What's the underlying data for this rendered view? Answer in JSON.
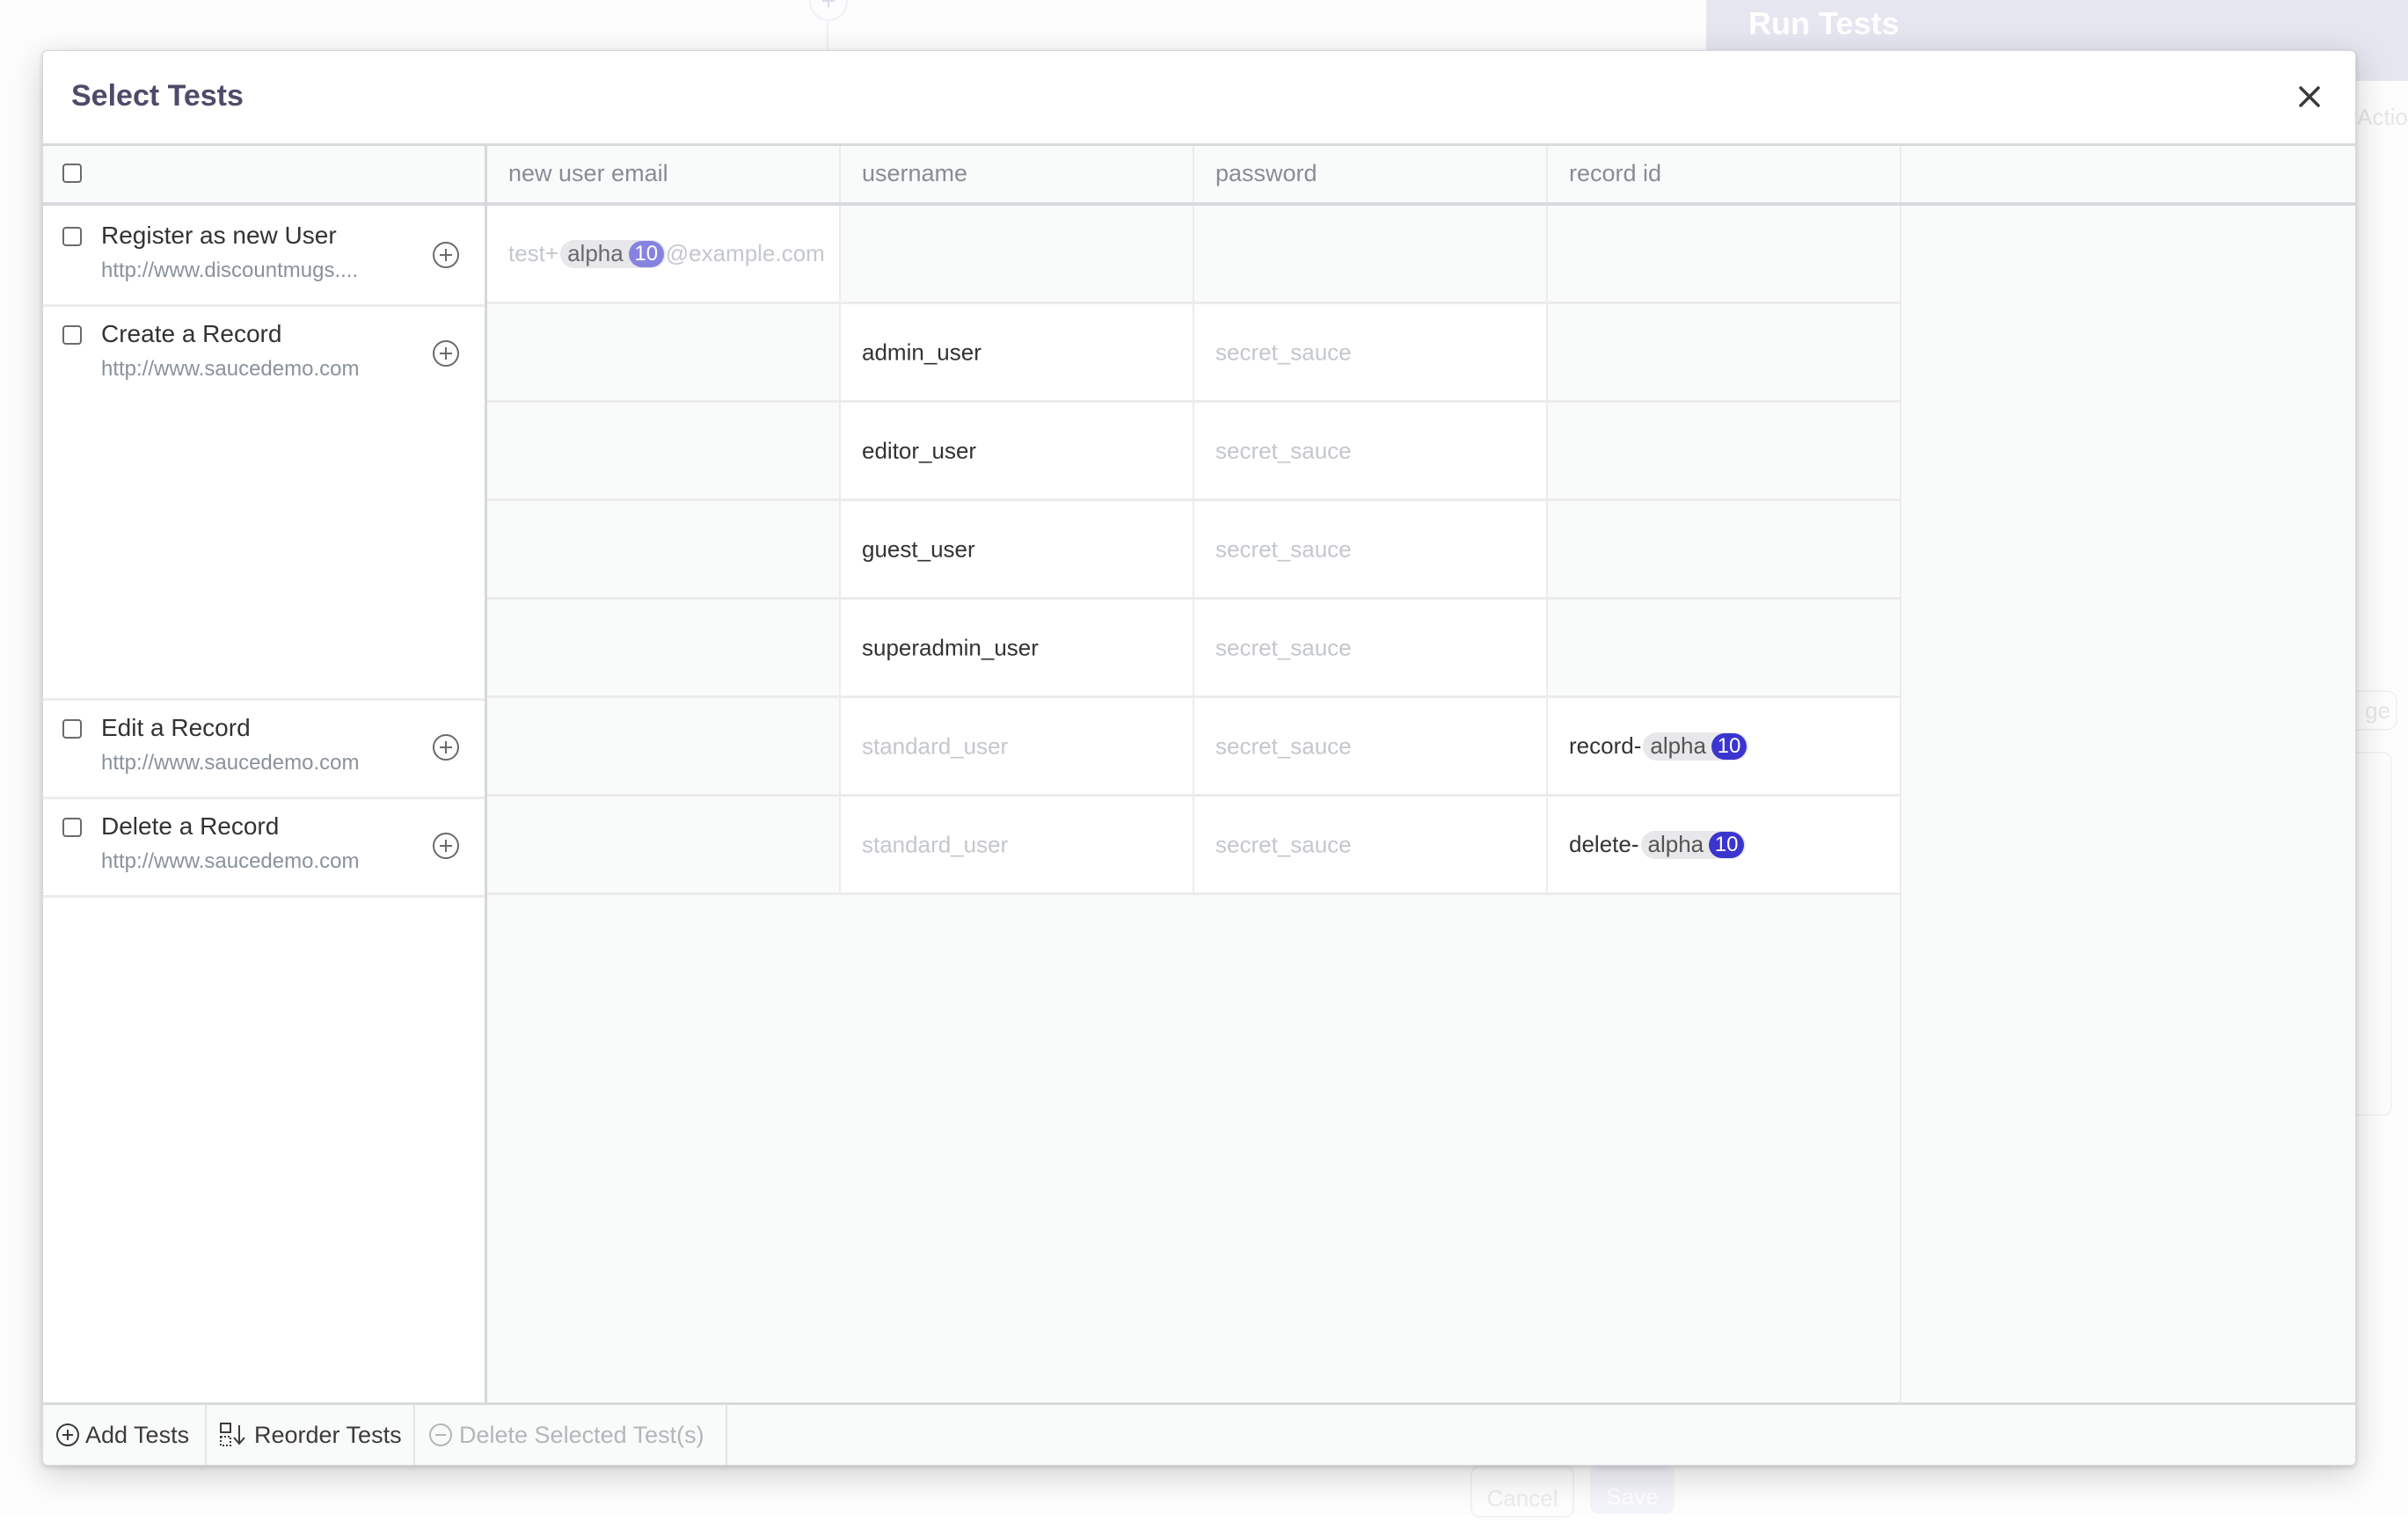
{
  "background": {
    "run_tests_title": "Run Tests",
    "actions_label": "Action",
    "tag_label": "ge",
    "cancel_label": "Cancel",
    "save_label": "Save"
  },
  "modal": {
    "title": "Select Tests",
    "close_icon": "close-icon"
  },
  "columns": [
    "new user email",
    "username",
    "password",
    "record id"
  ],
  "tests": [
    {
      "name": "Register as new User",
      "url": "http://www.discountmugs....",
      "checked": false
    },
    {
      "name": "Create a Record",
      "url": "http://www.saucedemo.com",
      "checked": false
    },
    {
      "name": "Edit a Record",
      "url": "http://www.saucedemo.com",
      "checked": false
    },
    {
      "name": "Delete a Record",
      "url": "http://www.saucedemo.com",
      "checked": false
    }
  ],
  "rows": [
    {
      "test": 0,
      "cells": [
        {
          "prefix": "test+",
          "chip": "alpha",
          "badge": "10",
          "suffix": "@example.com",
          "style": "muted"
        },
        null,
        null,
        null
      ]
    },
    {
      "test": 1,
      "cells": [
        null,
        {
          "text": "admin_user",
          "style": "dark"
        },
        {
          "text": "secret_sauce",
          "style": "muted"
        },
        null
      ]
    },
    {
      "test": 1,
      "cells": [
        null,
        {
          "text": "editor_user",
          "style": "dark"
        },
        {
          "text": "secret_sauce",
          "style": "muted"
        },
        null
      ]
    },
    {
      "test": 1,
      "cells": [
        null,
        {
          "text": "guest_user",
          "style": "dark"
        },
        {
          "text": "secret_sauce",
          "style": "muted"
        },
        null
      ]
    },
    {
      "test": 1,
      "cells": [
        null,
        {
          "text": "superadmin_user",
          "style": "dark"
        },
        {
          "text": "secret_sauce",
          "style": "muted"
        },
        null
      ]
    },
    {
      "test": 2,
      "cells": [
        null,
        {
          "text": "standard_user",
          "style": "muted"
        },
        {
          "text": "secret_sauce",
          "style": "muted"
        },
        {
          "prefix": "record-",
          "chip": "alpha",
          "badge": "10",
          "suffix": "",
          "style": "dark"
        }
      ]
    },
    {
      "test": 3,
      "cells": [
        null,
        {
          "text": "standard_user",
          "style": "muted"
        },
        {
          "text": "secret_sauce",
          "style": "muted"
        },
        {
          "prefix": "delete-",
          "chip": "alpha",
          "badge": "10",
          "suffix": "",
          "style": "dark"
        }
      ]
    }
  ],
  "footer": {
    "add_tests": "Add Tests",
    "reorder_tests": "Reorder Tests",
    "delete_selected": "Delete Selected Test(s)"
  },
  "colors": {
    "title": "#4e4b6a",
    "badge_active": "#3b35cf",
    "badge_muted": "#8683e0"
  }
}
